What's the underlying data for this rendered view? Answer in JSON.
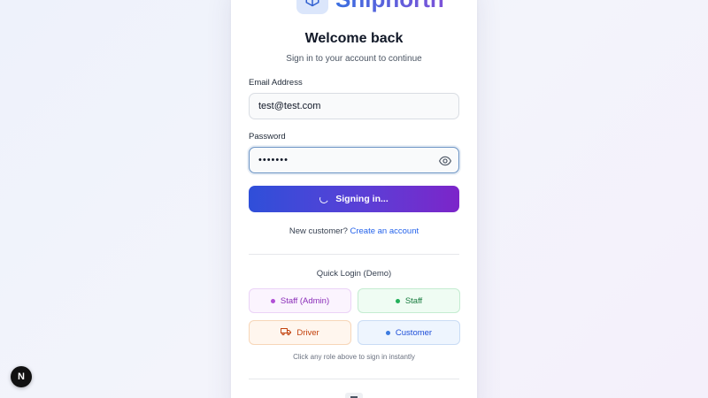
{
  "brand": {
    "name": "Shipnorth",
    "icon": "box-icon"
  },
  "header": {
    "title": "Welcome back",
    "subtitle": "Sign in to your account to continue"
  },
  "form": {
    "email_label": "Email Address",
    "email_value": "test@test.com",
    "password_label": "Password",
    "password_masked": "•••••••",
    "submit_label": "Signing in...",
    "submit_state": "loading"
  },
  "register": {
    "prompt": "New customer?",
    "link_label": "Create an account"
  },
  "quick_login": {
    "title": "Quick Login (Demo)",
    "roles": [
      {
        "label": "Staff (Admin)",
        "color": "#8a2db8"
      },
      {
        "label": "Staff",
        "color": "#167a3d"
      },
      {
        "label": "Driver",
        "color": "#c2410c",
        "icon": "truck-icon"
      },
      {
        "label": "Customer",
        "color": "#1d4ed8"
      }
    ],
    "hint": "Click any role above to sign in instantly"
  },
  "dev_badge": {
    "label": "N"
  },
  "colors": {
    "button_gradient_start": "#2f4fd9",
    "button_gradient_end": "#7c25c9",
    "link": "#2563eb"
  }
}
